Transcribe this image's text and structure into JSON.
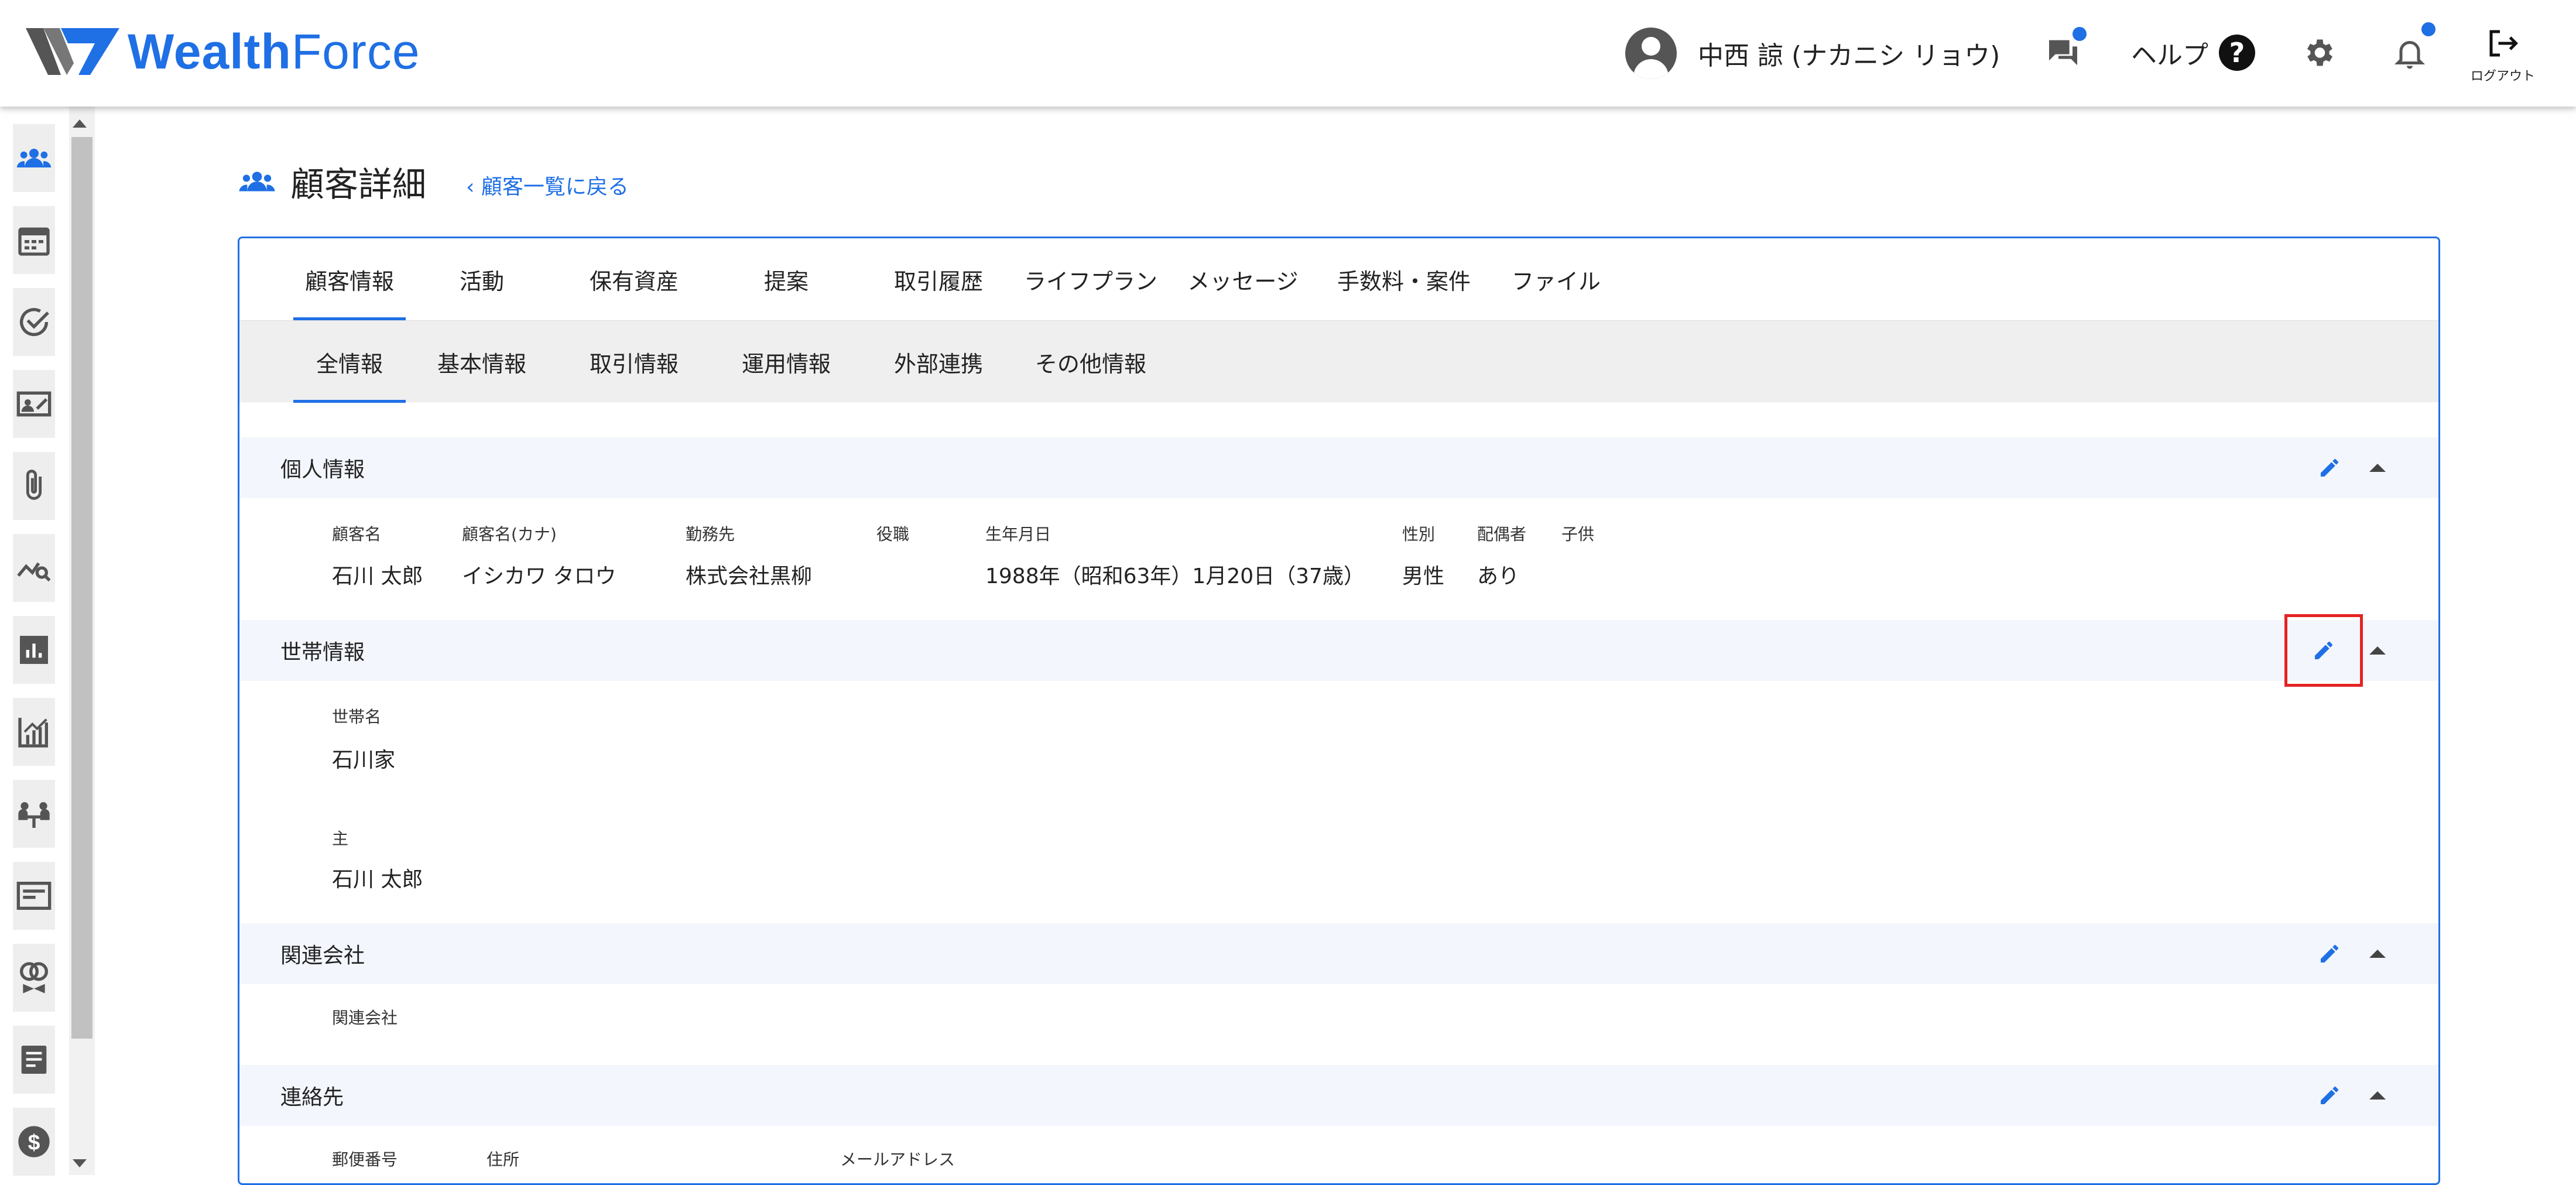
{
  "app": {
    "logo_text_bold": "Wealth",
    "logo_text": "Force",
    "brand_color": "#1f6fe5"
  },
  "header": {
    "user_name": "中西 諒 (ナカニシ リョウ)",
    "help_label": "ヘルプ",
    "help_glyph": "?",
    "logout_label": "ログアウト",
    "icons": [
      "user-avatar-icon",
      "chat-icon",
      "help-icon",
      "gear-icon",
      "bell-icon",
      "logout-icon"
    ]
  },
  "sidebar": {
    "items": [
      "customers-icon",
      "calendar-icon",
      "check-circle-icon",
      "contact-card-icon",
      "paperclip-icon",
      "chart-search-icon",
      "bar-chart-icon",
      "growth-chart-icon",
      "meeting-icon",
      "document-icon",
      "rings-icon",
      "notes-icon",
      "dollar-icon"
    ]
  },
  "page": {
    "title": "顧客詳細",
    "back_link": "顧客一覧に戻る"
  },
  "tabs": [
    "顧客情報",
    "活動",
    "保有資産",
    "提案",
    "取引履歴",
    "ライフプラン",
    "メッセージ",
    "手数料・案件",
    "ファイル"
  ],
  "active_tab": "顧客情報",
  "subtabs": [
    "全情報",
    "基本情報",
    "取引情報",
    "運用情報",
    "外部連携",
    "その他情報"
  ],
  "active_subtab": "全情報",
  "sections": {
    "personal": {
      "title": "個人情報",
      "labels": {
        "name": "顧客名",
        "kana": "顧客名(カナ)",
        "employer": "勤務先",
        "position": "役職",
        "birthdate": "生年月日",
        "gender": "性別",
        "spouse": "配偶者",
        "children": "子供"
      },
      "values": {
        "name": "石川 太郎",
        "kana": "イシカワ タロウ",
        "employer": "株式会社黒柳",
        "position": "",
        "birthdate": "1988年（昭和63年）1月20日（37歳）",
        "gender": "男性",
        "spouse": "あり",
        "children": ""
      }
    },
    "household": {
      "title": "世帯情報",
      "labels": {
        "household_name": "世帯名",
        "head": "主"
      },
      "values": {
        "household_name": "石川家",
        "head": "石川 太郎"
      }
    },
    "related": {
      "title": "関連会社",
      "labels": {
        "company": "関連会社"
      }
    },
    "contact": {
      "title": "連絡先",
      "labels": {
        "postal": "郵便番号",
        "address": "住所",
        "email": "メールアドレス"
      }
    }
  }
}
